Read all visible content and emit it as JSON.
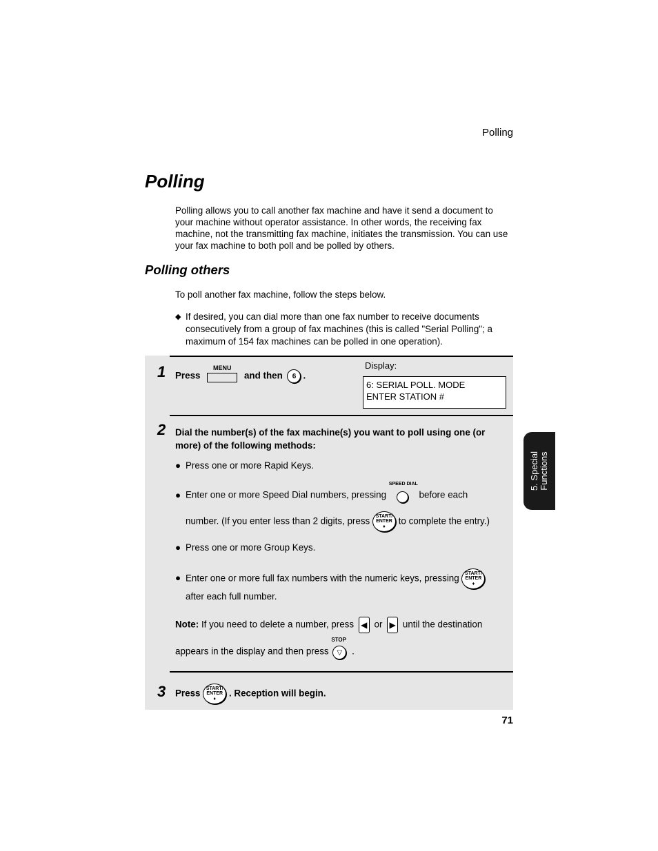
{
  "header": {
    "running_title": "Polling"
  },
  "title": "Polling",
  "intro": "Polling allows you to call another fax machine and have it send a document to your machine without operator assistance. In other words, the receiving fax machine, not the transmitting fax machine, initiates the transmission. You can use your fax machine to both poll and be polled by others.",
  "section": {
    "title": "Polling others",
    "lead": "To poll another fax machine, follow the steps below.",
    "note_item": "If desired, you can dial more than one fax number to receive documents consecutively from a group of fax machines (this is called \"Serial Polling\"; a maximum of 154 fax machines can be polled in one operation)."
  },
  "steps": {
    "step1": {
      "number": "1",
      "press": "Press",
      "menu_key": "MENU",
      "and_then": "and then",
      "key6": "6",
      "period": ".",
      "display_label": "Display:",
      "display_line1": "6: SERIAL POLL. MODE",
      "display_line2": "ENTER STATION #"
    },
    "step2": {
      "number": "2",
      "instruction": "Dial the number(s) of the fax machine(s) you want to poll using one (or more) of the following methods:",
      "bullet1": "Press one or more Rapid Keys.",
      "bullet2_a": "Enter one or more Speed Dial numbers, pressing",
      "speed_dial_label": "SPEED DIAL",
      "bullet2_b": "before each",
      "bullet2_c": "number. (If you enter less than 2 digits, press",
      "bullet2_d": "to complete the entry.)",
      "bullet3": "Press one or more Group Keys.",
      "bullet4_a": "Enter one or more full fax numbers with the numeric keys, pressing",
      "bullet4_b": "after each full number.",
      "note_label": "Note:",
      "note_a": "If you need to delete a number, press",
      "note_or": "or",
      "note_b": "until the destination",
      "note_c": "appears in the display and then press",
      "stop_label": "STOP",
      "note_end": "."
    },
    "step3": {
      "number": "3",
      "press": "Press",
      "text": ". Reception will begin."
    },
    "start_key_line1": "START/",
    "start_key_line2": "ENTER",
    "start_key_symbol": "♦"
  },
  "page_number": "71",
  "side_tab": {
    "line1": "5. Special",
    "line2": "Functions"
  }
}
